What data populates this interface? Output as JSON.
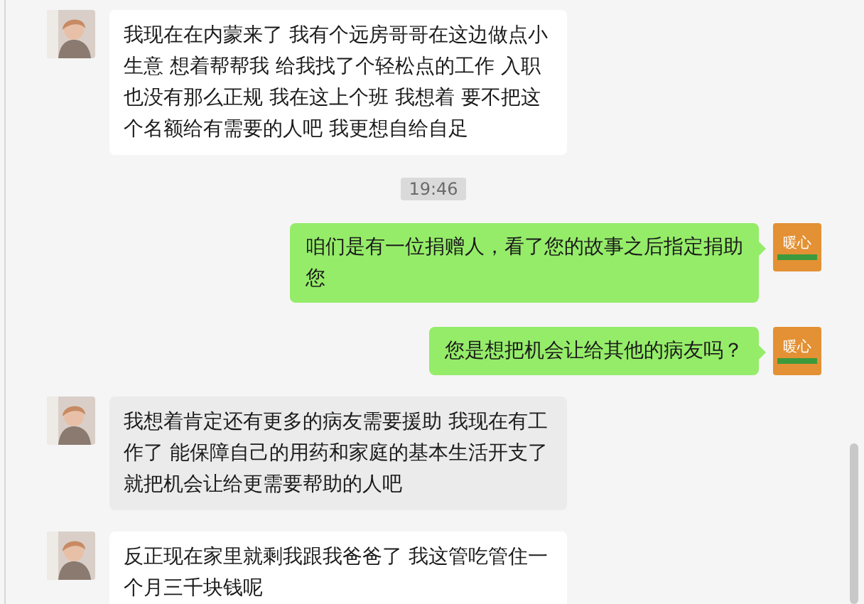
{
  "messages": [
    {
      "kind": "incoming",
      "text": "我现在在内蒙来了 我有个远房哥哥在这边做点小生意 想着帮帮我 给我找了个轻松点的工作 入职也没有那么正规 我在这上个班 我想着 要不把这个名额给有需要的人吧 我更想自给自足",
      "highlighted": false
    },
    {
      "kind": "time",
      "text": "19:46"
    },
    {
      "kind": "outgoing",
      "text": "咱们是有一位捐赠人，看了您的故事之后指定捐助您",
      "avatar_label": "暖心"
    },
    {
      "kind": "outgoing",
      "text": "您是想把机会让给其他的病友吗？",
      "avatar_label": "暖心"
    },
    {
      "kind": "incoming",
      "text": "我想着肯定还有更多的病友需要援助 我现在有工作了 能保障自己的用药和家庭的基本生活开支了就把机会让给更需要帮助的人吧",
      "highlighted": true
    },
    {
      "kind": "incoming",
      "text": "反正现在家里就剩我跟我爸爸了 我这管吃管住一个月三千块钱呢",
      "highlighted": false
    }
  ]
}
